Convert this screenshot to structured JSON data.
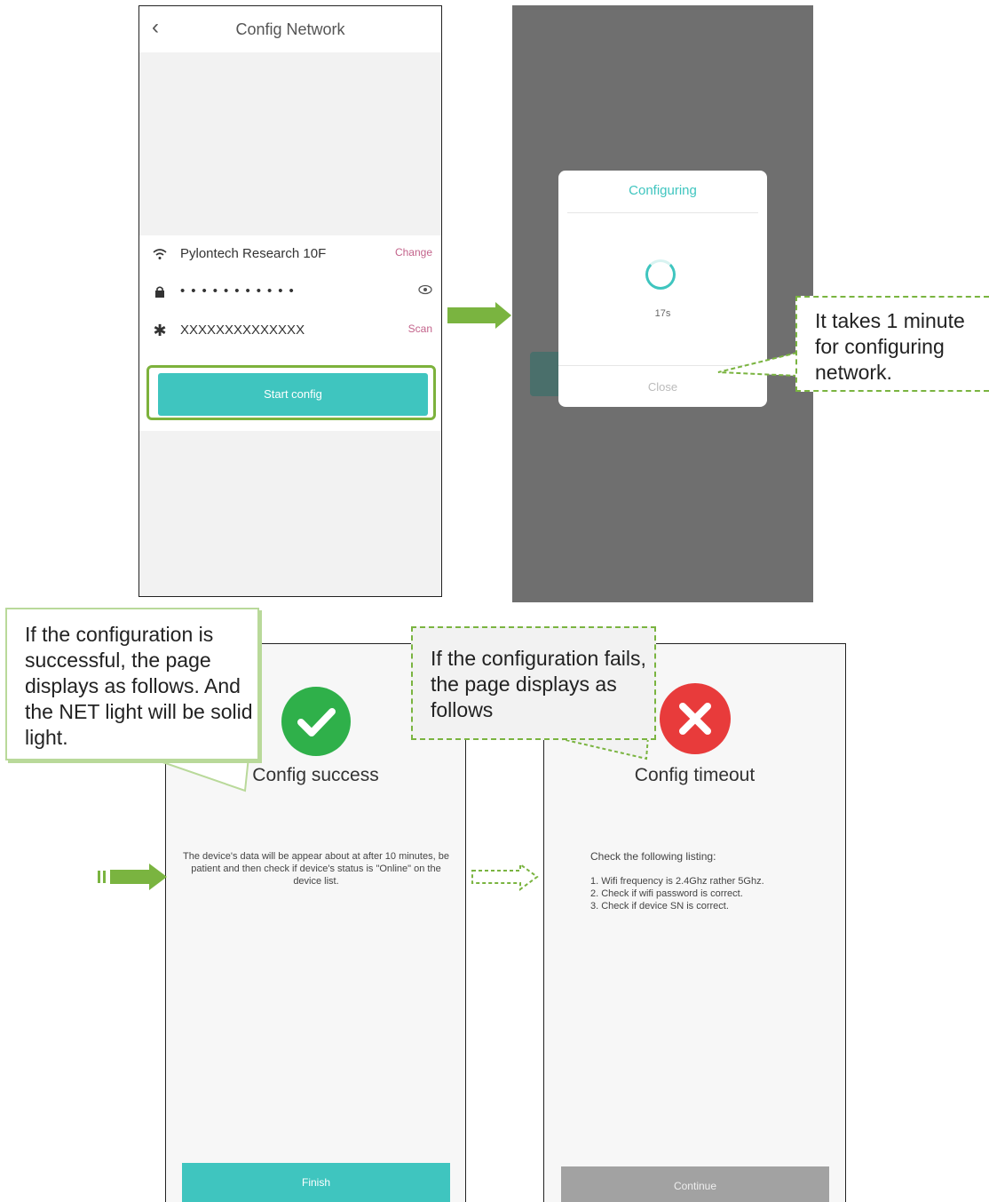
{
  "screen1": {
    "title": "Config Network",
    "back_icon": "chevron-left-icon",
    "wifi": {
      "icon": "wifi-icon",
      "ssid": "Pylontech Research 10F",
      "action": "Change"
    },
    "password": {
      "icon": "lock-icon",
      "masked_value": "•••••••••••",
      "toggle_icon": "eye-icon"
    },
    "sn": {
      "icon": "asterisk-icon",
      "value": "XXXXXXXXXXXXXX",
      "action": "Scan"
    },
    "start_button": "Start config"
  },
  "screen2": {
    "dialog_title": "Configuring",
    "seconds": "17s",
    "close_label": "Close"
  },
  "callout_configuring": "It takes 1 minute for configuring network.",
  "screen3": {
    "title": "Config success",
    "description": "The device's data will be appear about at after 10 minutes, be patient and then check if device's status is \"Online\" on the device list.",
    "finish_button": "Finish"
  },
  "callout_success": "If the configuration is successful, the page displays as follows. And the NET light will be solid light.",
  "screen4": {
    "title": "Config timeout",
    "check_heading": "Check the following listing:",
    "items": [
      "1. Wifi frequency is 2.4Ghz rather 5Ghz.",
      "2. Check if wifi password is correct.",
      "3. Check if device SN is correct."
    ],
    "continue_button": "Continue"
  },
  "callout_fail": "If the configuration fails, the page displays as follows",
  "colors": {
    "teal": "#3fc5bf",
    "green_arrow": "#7ab440",
    "success_green": "#2fb04a",
    "error_red": "#e83b3b",
    "overlay_gray": "#6f6f6f",
    "link_pink": "#c3638b"
  }
}
